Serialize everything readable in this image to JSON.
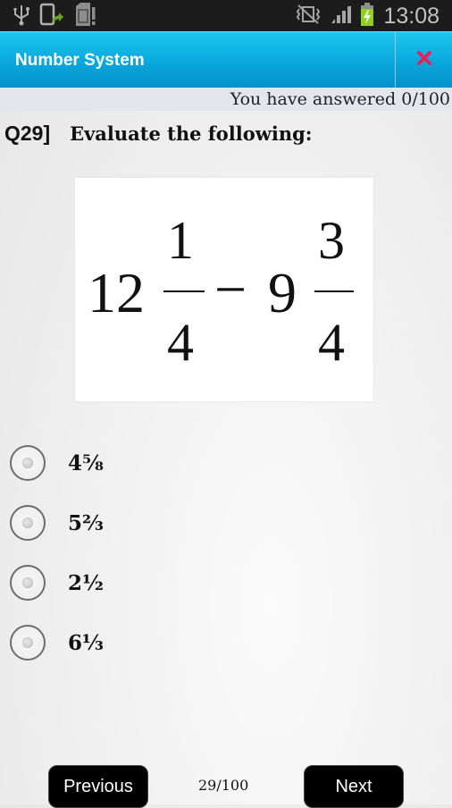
{
  "status_bar": {
    "left_icons": [
      "usb-icon",
      "phone-update-icon",
      "sd-card-icon"
    ],
    "right_icons": [
      "vibrate-icon",
      "signal-icon",
      "battery-charging-icon"
    ],
    "time": "13:08"
  },
  "title_bar": {
    "title": "Number System",
    "close_icon": "close-icon",
    "close_color": "#e0245e"
  },
  "progress": {
    "answered_text": "You have answered 0/100"
  },
  "question": {
    "number": "Q29]",
    "text": "Evaluate the following:",
    "expression": {
      "term1_whole": "12",
      "term1_num": "1",
      "term1_den": "4",
      "operator": "−",
      "term2_whole": "9",
      "term2_num": "3",
      "term2_den": "4"
    }
  },
  "options": [
    {
      "label": "4⅝",
      "selected": false
    },
    {
      "label": "5⅔",
      "selected": false
    },
    {
      "label": "2½",
      "selected": false
    },
    {
      "label": "6⅓",
      "selected": false
    }
  ],
  "navigation": {
    "previous_label": "Previous",
    "page": "29/100",
    "next_label": "Next"
  }
}
